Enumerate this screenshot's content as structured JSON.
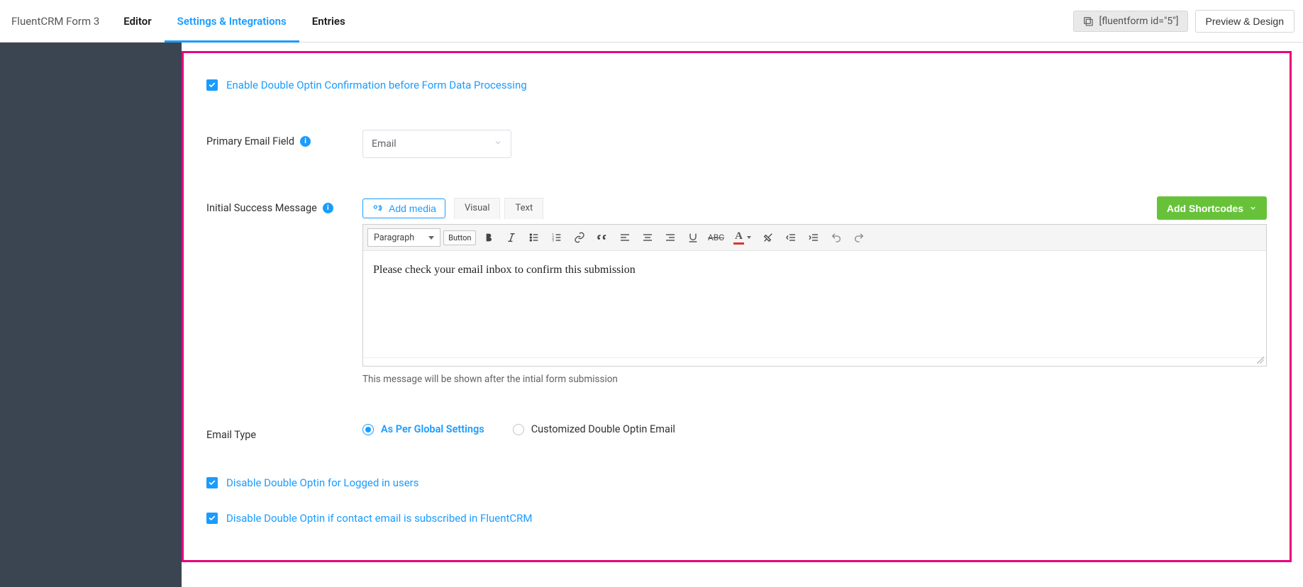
{
  "header": {
    "title": "FluentCRM Form 3",
    "tabs": [
      {
        "label": "Editor"
      },
      {
        "label": "Settings & Integrations",
        "active": true
      },
      {
        "label": "Entries"
      }
    ],
    "shortcode": "[fluentform id=\"5\"]",
    "preview_label": "Preview & Design"
  },
  "panel": {
    "enable_label": "Enable Double Optin Confirmation before Form Data Processing",
    "primary_email": {
      "label": "Primary Email Field",
      "value": "Email"
    },
    "success_msg": {
      "label": "Initial Success Message",
      "add_media": "Add media",
      "tab_visual": "Visual",
      "tab_text": "Text",
      "add_shortcodes": "Add Shortcodes",
      "paragraph_label": "Paragraph",
      "button_chip": "Button",
      "body": "Please check your email inbox to confirm this submission",
      "help": "This message will be shown after the intial form submission"
    },
    "email_type": {
      "label": "Email Type",
      "option_global": "As Per Global Settings",
      "option_custom": "Customized Double Optin Email"
    },
    "disable_logged": "Disable Double Optin for Logged in users",
    "disable_subscribed": "Disable Double Optin if contact email is subscribed in FluentCRM"
  }
}
